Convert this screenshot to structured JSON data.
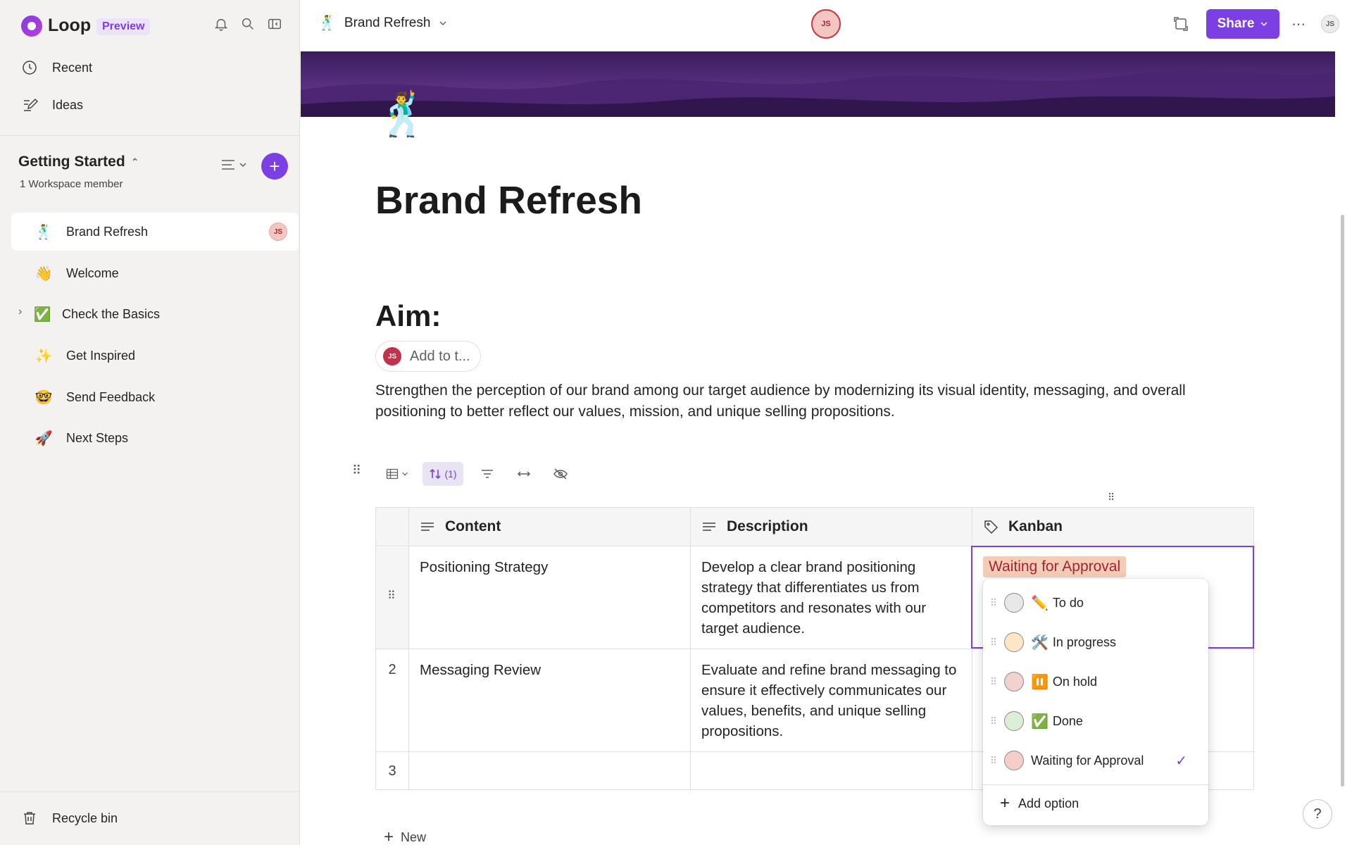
{
  "app": {
    "name": "Loop",
    "badge": "Preview"
  },
  "sidebar": {
    "nav": [
      {
        "label": "Recent",
        "icon": "clock-icon"
      },
      {
        "label": "Ideas",
        "icon": "ideas-icon"
      }
    ],
    "workspace": {
      "title": "Getting Started",
      "members": "1 Workspace member"
    },
    "pages": [
      {
        "label": "Brand Refresh",
        "emoji": "🕺",
        "active": true,
        "avatar": "JS"
      },
      {
        "label": "Welcome",
        "emoji": "👋"
      },
      {
        "label": "Check the Basics",
        "emoji": "✅"
      },
      {
        "label": "Get Inspired",
        "emoji": "✨"
      },
      {
        "label": "Send Feedback",
        "emoji": "🤓"
      },
      {
        "label": "Next Steps",
        "emoji": "🚀"
      }
    ],
    "recycle": "Recycle bin"
  },
  "header": {
    "crumb_emoji": "🕺",
    "crumb": "Brand Refresh",
    "presence_avatar": "JS",
    "share": "Share",
    "user_avatar": "JS"
  },
  "page": {
    "emoji": "🕺",
    "title": "Brand Refresh",
    "aim_heading": "Aim:",
    "addto_avatar": "JS",
    "addto_label": "Add to t...",
    "aim_text": "Strengthen the perception of our brand among our target audience by modernizing its visual identity, messaging, and overall positioning to better reflect our values, mission, and unique selling propositions."
  },
  "toolbar": {
    "sort_label": "(1)"
  },
  "table": {
    "columns": [
      "Content",
      "Description",
      "Kanban"
    ],
    "rows": [
      {
        "num": "",
        "content": "Positioning Strategy",
        "description": "Develop a clear brand positioning strategy that differentiates us from competitors and resonates with our target audience.",
        "kanban": "Waiting for Approval"
      },
      {
        "num": "2",
        "content": "Messaging Review",
        "description": "Evaluate and refine brand messaging to ensure it effectively communicates our values, benefits, and unique selling propositions.",
        "kanban": ""
      },
      {
        "num": "3",
        "content": "",
        "description": "",
        "kanban": ""
      }
    ],
    "new_label": "New"
  },
  "dropdown": {
    "options": [
      {
        "emoji": "✏️",
        "label": "To do",
        "color": "#e8e8e8"
      },
      {
        "emoji": "🛠️",
        "label": "In progress",
        "color": "#fbe7c6"
      },
      {
        "emoji": "⏸️",
        "label": "On hold",
        "color": "#f3d1d0"
      },
      {
        "emoji": "✅",
        "label": "Done",
        "color": "#dcefd6"
      },
      {
        "emoji": "",
        "label": "Waiting for Approval",
        "color": "#f3cfc8",
        "selected": true
      }
    ],
    "add_option": "Add option"
  },
  "help": "?",
  "colors": {
    "accent": "#7b3fe4",
    "sidebar_bg": "#f3f2f1"
  }
}
